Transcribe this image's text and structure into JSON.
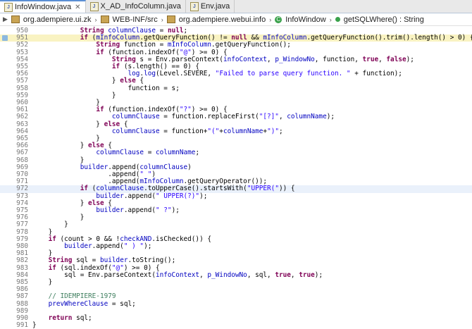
{
  "tabs": [
    {
      "label": "InfoWindow.java",
      "active": true
    },
    {
      "label": "X_AD_InfoColumn.java",
      "active": false
    },
    {
      "label": "Env.java",
      "active": false
    }
  ],
  "breadcrumb": {
    "project": "org.adempiere.ui.zk",
    "folder": "WEB-INF/src",
    "package": "org.adempiere.webui.info",
    "class": "InfoWindow",
    "method": "getSQLWhere() : String"
  },
  "lines": [
    {
      "n": "950",
      "text": "            String columnClause = null;"
    },
    {
      "n": "951",
      "text": "            if (mInfoColumn.getQueryFunction() != null && mInfoColumn.getQueryFunction().trim().length() > 0) {"
    },
    {
      "n": "952",
      "text": "                String function = mInfoColumn.getQueryFunction();"
    },
    {
      "n": "953",
      "text": "                if (function.indexOf(\"@\") >= 0) {"
    },
    {
      "n": "954",
      "text": "                    String s = Env.parseContext(infoContext, p_WindowNo, function, true, false);"
    },
    {
      "n": "955",
      "text": "                    if (s.length() == 0) {"
    },
    {
      "n": "956",
      "text": "                        log.log(Level.SEVERE, \"Failed to parse query function. \" + function);"
    },
    {
      "n": "957",
      "text": "                    } else {"
    },
    {
      "n": "958",
      "text": "                        function = s;"
    },
    {
      "n": "959",
      "text": "                    }"
    },
    {
      "n": "960",
      "text": "                }"
    },
    {
      "n": "961",
      "text": "                if (function.indexOf(\"?\") >= 0) {"
    },
    {
      "n": "962",
      "text": "                    columnClause = function.replaceFirst(\"[?]\", columnName);"
    },
    {
      "n": "963",
      "text": "                } else {"
    },
    {
      "n": "964",
      "text": "                    columnClause = function+\"(\"+columnName+\")\";"
    },
    {
      "n": "965",
      "text": "                }"
    },
    {
      "n": "966",
      "text": "            } else {"
    },
    {
      "n": "967",
      "text": "                columnClause = columnName;"
    },
    {
      "n": "968",
      "text": "            }"
    },
    {
      "n": "969",
      "text": "            builder.append(columnClause)"
    },
    {
      "n": "970",
      "text": "                   .append(\" \")"
    },
    {
      "n": "971",
      "text": "                   .append(mInfoColumn.getQueryOperator());"
    },
    {
      "n": "972",
      "text": "            if (columnClause.toUpperCase().startsWith(\"UPPER(\")) {"
    },
    {
      "n": "973",
      "text": "                builder.append(\" UPPER(?)\");"
    },
    {
      "n": "974",
      "text": "            } else {"
    },
    {
      "n": "975",
      "text": "                builder.append(\" ?\");"
    },
    {
      "n": "976",
      "text": "            }"
    },
    {
      "n": "977",
      "text": "        }"
    },
    {
      "n": "978",
      "text": "    }"
    },
    {
      "n": "979",
      "text": "    if (count > 0 && !checkAND.isChecked()) {"
    },
    {
      "n": "980",
      "text": "        builder.append(\" ) \");"
    },
    {
      "n": "981",
      "text": "    }"
    },
    {
      "n": "982",
      "text": "    String sql = builder.toString();"
    },
    {
      "n": "983",
      "text": "    if (sql.indexOf(\"@\") >= 0) {"
    },
    {
      "n": "984",
      "text": "        sql = Env.parseContext(infoContext, p_WindowNo, sql, true, true);"
    },
    {
      "n": "985",
      "text": "    }"
    },
    {
      "n": "986",
      "text": ""
    },
    {
      "n": "987",
      "text": "    // IDEMPIERE-1979"
    },
    {
      "n": "988",
      "text": "    prevWhereClause = sql;"
    },
    {
      "n": "989",
      "text": ""
    },
    {
      "n": "990",
      "text": "    return sql;"
    },
    {
      "n": "991",
      "text": "}"
    }
  ],
  "keywords": [
    "String",
    "if",
    "else",
    "null",
    "true",
    "false",
    "return"
  ],
  "fields": [
    "mInfoColumn",
    "p_WindowNo",
    "infoContext",
    "columnName",
    "columnClause",
    "builder",
    "checkAND",
    "prevWhereClause",
    "log"
  ],
  "colors": {
    "keyword": "#7f0055",
    "field": "#0000c0",
    "string": "#2a00ff",
    "comment": "#3f7f5f",
    "line_number": "#7a7a7a",
    "highlight": "#e8eefb",
    "current_line": "#eaf1fb"
  }
}
